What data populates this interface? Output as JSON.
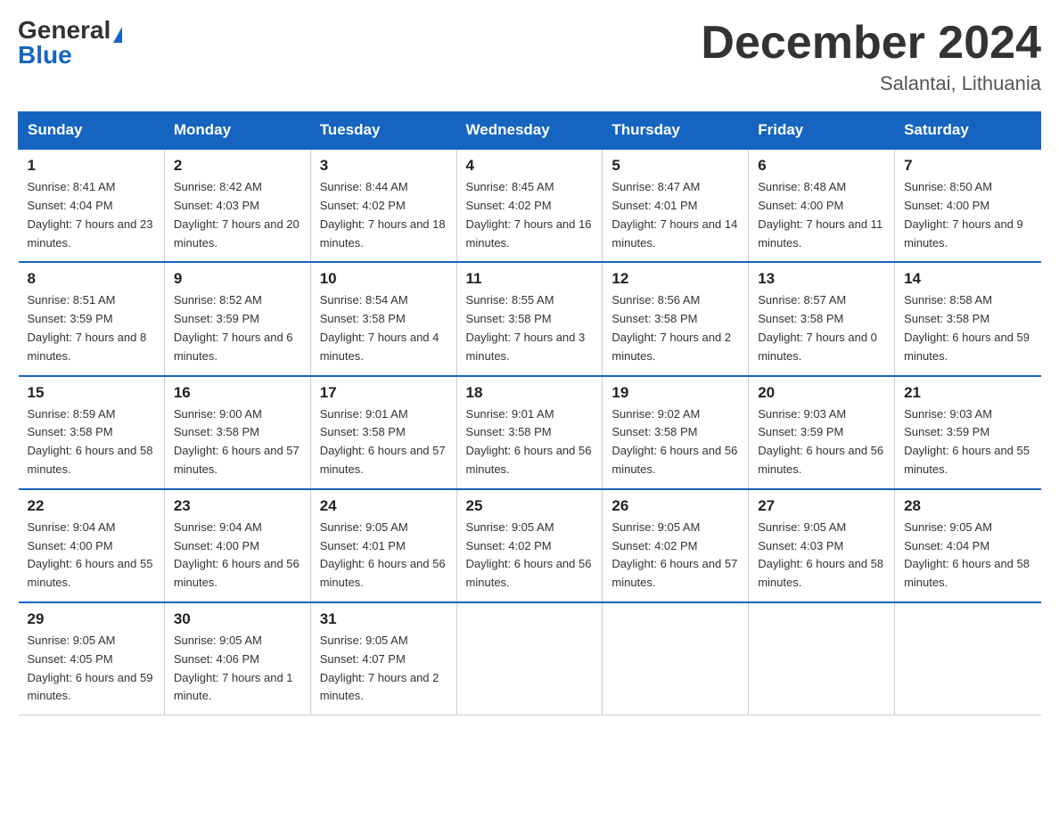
{
  "header": {
    "logo_general": "General",
    "logo_blue": "Blue",
    "month_title": "December 2024",
    "location": "Salantai, Lithuania"
  },
  "days_of_week": [
    "Sunday",
    "Monday",
    "Tuesday",
    "Wednesday",
    "Thursday",
    "Friday",
    "Saturday"
  ],
  "weeks": [
    [
      {
        "day": "1",
        "sunrise": "8:41 AM",
        "sunset": "4:04 PM",
        "daylight": "7 hours and 23 minutes."
      },
      {
        "day": "2",
        "sunrise": "8:42 AM",
        "sunset": "4:03 PM",
        "daylight": "7 hours and 20 minutes."
      },
      {
        "day": "3",
        "sunrise": "8:44 AM",
        "sunset": "4:02 PM",
        "daylight": "7 hours and 18 minutes."
      },
      {
        "day": "4",
        "sunrise": "8:45 AM",
        "sunset": "4:02 PM",
        "daylight": "7 hours and 16 minutes."
      },
      {
        "day": "5",
        "sunrise": "8:47 AM",
        "sunset": "4:01 PM",
        "daylight": "7 hours and 14 minutes."
      },
      {
        "day": "6",
        "sunrise": "8:48 AM",
        "sunset": "4:00 PM",
        "daylight": "7 hours and 11 minutes."
      },
      {
        "day": "7",
        "sunrise": "8:50 AM",
        "sunset": "4:00 PM",
        "daylight": "7 hours and 9 minutes."
      }
    ],
    [
      {
        "day": "8",
        "sunrise": "8:51 AM",
        "sunset": "3:59 PM",
        "daylight": "7 hours and 8 minutes."
      },
      {
        "day": "9",
        "sunrise": "8:52 AM",
        "sunset": "3:59 PM",
        "daylight": "7 hours and 6 minutes."
      },
      {
        "day": "10",
        "sunrise": "8:54 AM",
        "sunset": "3:58 PM",
        "daylight": "7 hours and 4 minutes."
      },
      {
        "day": "11",
        "sunrise": "8:55 AM",
        "sunset": "3:58 PM",
        "daylight": "7 hours and 3 minutes."
      },
      {
        "day": "12",
        "sunrise": "8:56 AM",
        "sunset": "3:58 PM",
        "daylight": "7 hours and 2 minutes."
      },
      {
        "day": "13",
        "sunrise": "8:57 AM",
        "sunset": "3:58 PM",
        "daylight": "7 hours and 0 minutes."
      },
      {
        "day": "14",
        "sunrise": "8:58 AM",
        "sunset": "3:58 PM",
        "daylight": "6 hours and 59 minutes."
      }
    ],
    [
      {
        "day": "15",
        "sunrise": "8:59 AM",
        "sunset": "3:58 PM",
        "daylight": "6 hours and 58 minutes."
      },
      {
        "day": "16",
        "sunrise": "9:00 AM",
        "sunset": "3:58 PM",
        "daylight": "6 hours and 57 minutes."
      },
      {
        "day": "17",
        "sunrise": "9:01 AM",
        "sunset": "3:58 PM",
        "daylight": "6 hours and 57 minutes."
      },
      {
        "day": "18",
        "sunrise": "9:01 AM",
        "sunset": "3:58 PM",
        "daylight": "6 hours and 56 minutes."
      },
      {
        "day": "19",
        "sunrise": "9:02 AM",
        "sunset": "3:58 PM",
        "daylight": "6 hours and 56 minutes."
      },
      {
        "day": "20",
        "sunrise": "9:03 AM",
        "sunset": "3:59 PM",
        "daylight": "6 hours and 56 minutes."
      },
      {
        "day": "21",
        "sunrise": "9:03 AM",
        "sunset": "3:59 PM",
        "daylight": "6 hours and 55 minutes."
      }
    ],
    [
      {
        "day": "22",
        "sunrise": "9:04 AM",
        "sunset": "4:00 PM",
        "daylight": "6 hours and 55 minutes."
      },
      {
        "day": "23",
        "sunrise": "9:04 AM",
        "sunset": "4:00 PM",
        "daylight": "6 hours and 56 minutes."
      },
      {
        "day": "24",
        "sunrise": "9:05 AM",
        "sunset": "4:01 PM",
        "daylight": "6 hours and 56 minutes."
      },
      {
        "day": "25",
        "sunrise": "9:05 AM",
        "sunset": "4:02 PM",
        "daylight": "6 hours and 56 minutes."
      },
      {
        "day": "26",
        "sunrise": "9:05 AM",
        "sunset": "4:02 PM",
        "daylight": "6 hours and 57 minutes."
      },
      {
        "day": "27",
        "sunrise": "9:05 AM",
        "sunset": "4:03 PM",
        "daylight": "6 hours and 58 minutes."
      },
      {
        "day": "28",
        "sunrise": "9:05 AM",
        "sunset": "4:04 PM",
        "daylight": "6 hours and 58 minutes."
      }
    ],
    [
      {
        "day": "29",
        "sunrise": "9:05 AM",
        "sunset": "4:05 PM",
        "daylight": "6 hours and 59 minutes."
      },
      {
        "day": "30",
        "sunrise": "9:05 AM",
        "sunset": "4:06 PM",
        "daylight": "7 hours and 1 minute."
      },
      {
        "day": "31",
        "sunrise": "9:05 AM",
        "sunset": "4:07 PM",
        "daylight": "7 hours and 2 minutes."
      },
      null,
      null,
      null,
      null
    ]
  ],
  "labels": {
    "sunrise": "Sunrise:",
    "sunset": "Sunset:",
    "daylight": "Daylight:"
  }
}
